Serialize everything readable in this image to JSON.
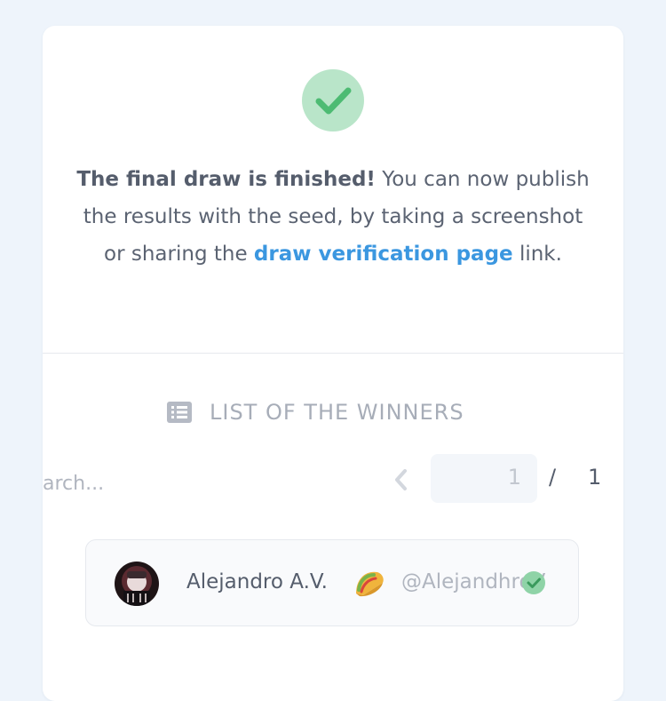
{
  "result": {
    "title_bold": "The final draw is finished!",
    "text_before_link": " You can now publish the results with the seed, by taking a screenshot or sharing the ",
    "link_label": "draw verification page",
    "text_after_link": " link."
  },
  "winners_section": {
    "title": "LIST OF THE WINNERS",
    "search": {
      "placeholder": "arch...",
      "value": ""
    },
    "pagination": {
      "current_page": "1",
      "separator": "/",
      "total_pages": "1"
    },
    "winners": [
      {
        "name": "Alejandro A.V.",
        "emoji_icon": "taco-icon",
        "handle": "@AlejandhroV",
        "verified": true
      }
    ]
  },
  "colors": {
    "success_green": "#4dbb73",
    "success_bg": "#b9e5c9",
    "link_blue": "#3b97e0",
    "background": "#eef4fb"
  }
}
